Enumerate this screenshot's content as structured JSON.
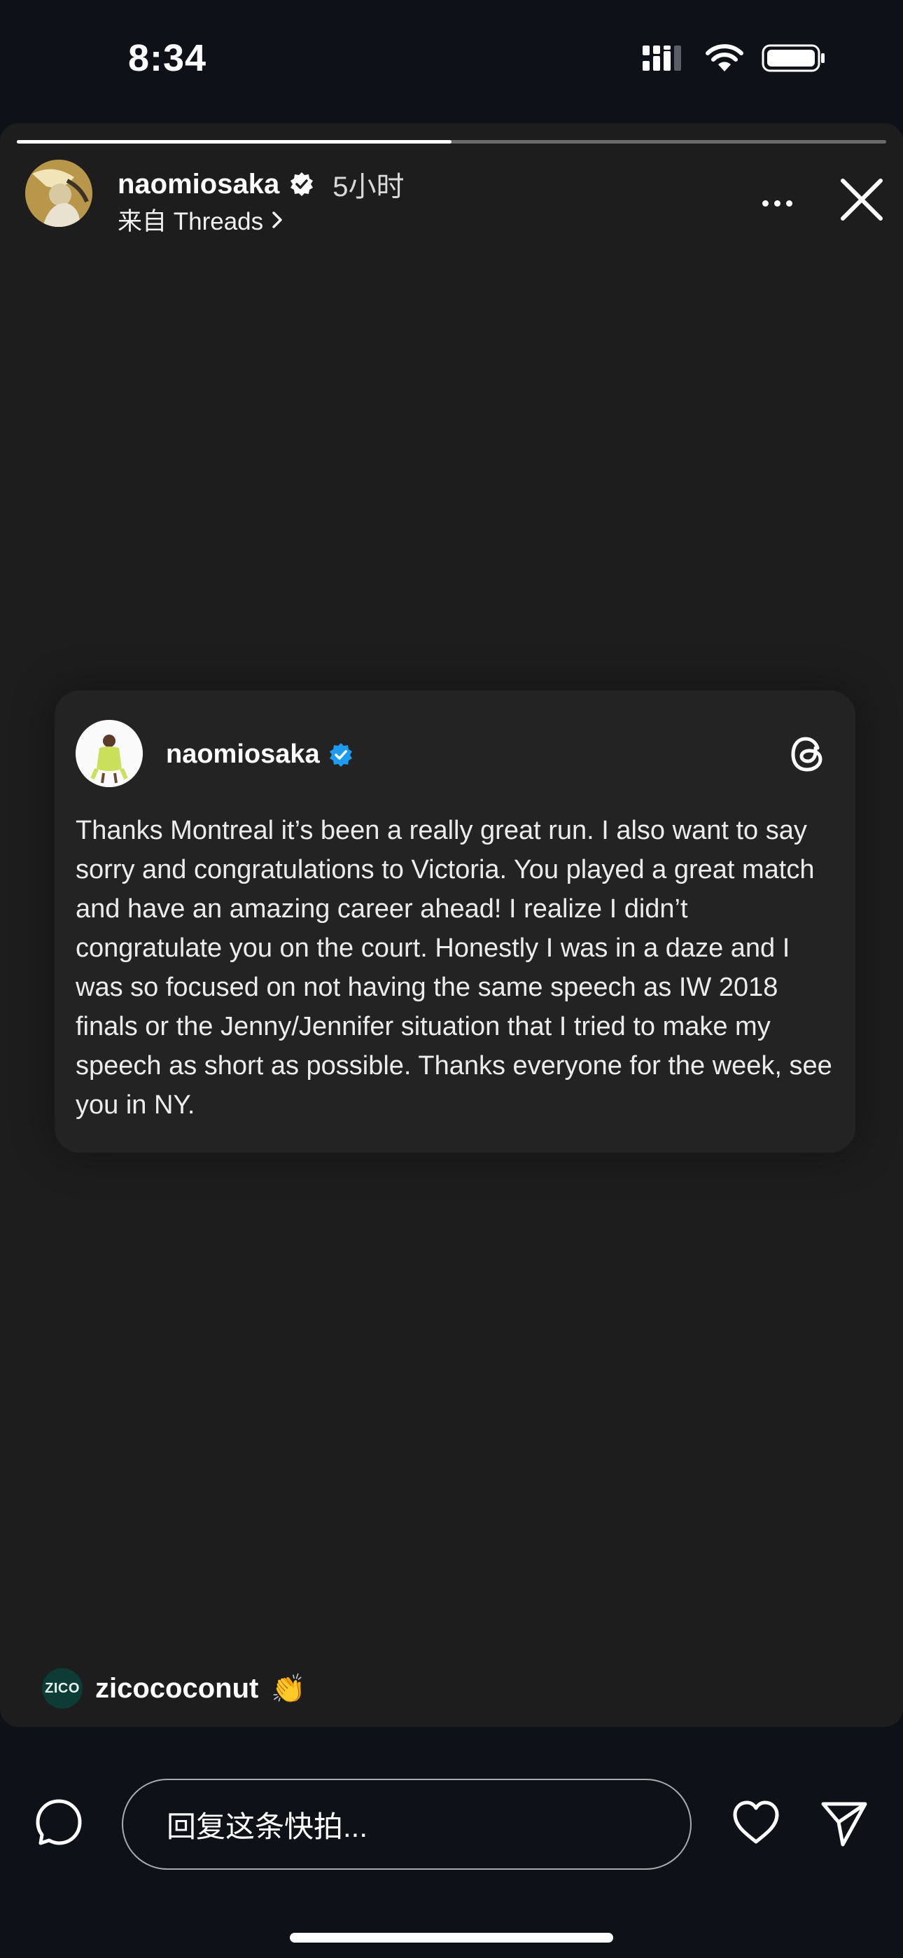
{
  "status_bar": {
    "time": "8:34"
  },
  "story": {
    "progress": 0.5,
    "author": {
      "username": "naomiosaka",
      "posted_ago": "5小时",
      "source": "来自 Threads"
    },
    "thread_post": {
      "username": "naomiosaka",
      "text": "Thanks Montreal it’s been a really great run. I also want to say sorry and congratulations to Victoria. You played a great match and have an amazing career ahead! I realize I didn’t congratulate you on the court. Honestly I was in a daze and I was so focused on not having the same speech as IW 2018 finals or the Jenny/Jennifer situation that I tried to make my speech as short as possible. Thanks everyone for the week, see you in NY."
    },
    "viewer_reply": {
      "avatar_text": "ZICO",
      "username": "zicococonut",
      "emoji": "👏"
    }
  },
  "bottom_bar": {
    "reply_placeholder": "回复这条快拍..."
  },
  "colors": {
    "background": "#0e1117",
    "story_background": "#1d1d1d",
    "card_background": "#232323",
    "verified_blue": "#1d9bf0"
  },
  "icons": {
    "status": [
      "cellular-signal-icon",
      "wifi-icon",
      "battery-icon"
    ],
    "story_header": [
      "verified-badge-icon",
      "chevron-right-icon",
      "more-icon",
      "close-icon"
    ],
    "card": [
      "verified-badge-icon",
      "threads-logo-icon"
    ],
    "bottom": [
      "camera-icon",
      "heart-icon",
      "send-icon"
    ]
  }
}
